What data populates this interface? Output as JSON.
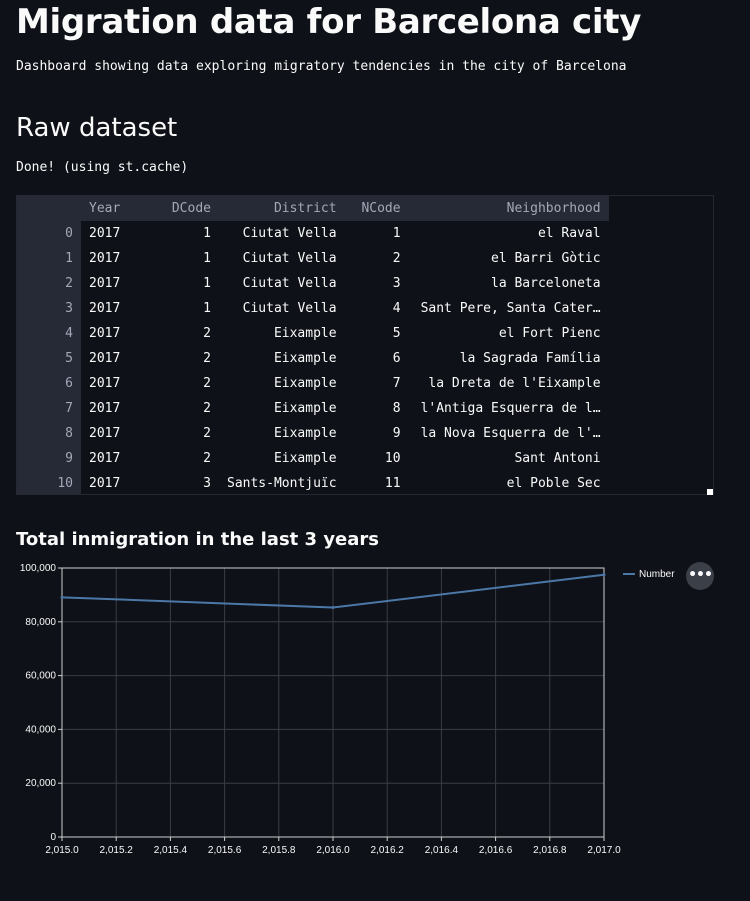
{
  "page": {
    "title": "Migration data for Barcelona city",
    "subtitle": "Dashboard showing data exploring migratory tendencies in the city of Barcelona",
    "section_title": "Raw dataset",
    "status": "Done! (using st.cache)"
  },
  "table": {
    "columns": [
      "Year",
      "DCode",
      "District",
      "NCode",
      "Neighborhood"
    ],
    "rows": [
      {
        "index": "0",
        "cells": [
          "2017",
          "1",
          "Ciutat Vella",
          "1",
          "el Raval"
        ]
      },
      {
        "index": "1",
        "cells": [
          "2017",
          "1",
          "Ciutat Vella",
          "2",
          "el Barri Gòtic"
        ]
      },
      {
        "index": "2",
        "cells": [
          "2017",
          "1",
          "Ciutat Vella",
          "3",
          "la Barceloneta"
        ]
      },
      {
        "index": "3",
        "cells": [
          "2017",
          "1",
          "Ciutat Vella",
          "4",
          "Sant Pere, Santa Cater…"
        ]
      },
      {
        "index": "4",
        "cells": [
          "2017",
          "2",
          "Eixample",
          "5",
          "el Fort Pienc"
        ]
      },
      {
        "index": "5",
        "cells": [
          "2017",
          "2",
          "Eixample",
          "6",
          "la Sagrada Família"
        ]
      },
      {
        "index": "6",
        "cells": [
          "2017",
          "2",
          "Eixample",
          "7",
          "la Dreta de l'Eixample"
        ]
      },
      {
        "index": "7",
        "cells": [
          "2017",
          "2",
          "Eixample",
          "8",
          "l'Antiga Esquerra de l…"
        ]
      },
      {
        "index": "8",
        "cells": [
          "2017",
          "2",
          "Eixample",
          "9",
          "la Nova Esquerra de l'…"
        ]
      },
      {
        "index": "9",
        "cells": [
          "2017",
          "2",
          "Eixample",
          "10",
          "Sant Antoni"
        ]
      },
      {
        "index": "10",
        "cells": [
          "2017",
          "3",
          "Sants-Montjuïc",
          "11",
          "el Poble Sec"
        ]
      }
    ]
  },
  "chart": {
    "title": "Total inmigration in the last 3 years",
    "menu_icon": "more-horizontal-icon",
    "menu_label": "•••"
  },
  "chart_data": {
    "type": "line",
    "title": "Total inmigration in the last 3 years",
    "xlabel": "",
    "ylabel": "",
    "xlim": [
      2015.0,
      2017.0
    ],
    "ylim": [
      0,
      100000
    ],
    "x_ticks": [
      "2,015.0",
      "2,015.2",
      "2,015.4",
      "2,015.6",
      "2,015.8",
      "2,016.0",
      "2,016.2",
      "2,016.4",
      "2,016.6",
      "2,016.8",
      "2,017.0"
    ],
    "y_ticks": [
      "0",
      "20,000",
      "40,000",
      "60,000",
      "80,000",
      "100,000"
    ],
    "grid": true,
    "legend_position": "right",
    "series": [
      {
        "name": "Number",
        "color": "#4c78a8",
        "x": [
          2015.0,
          2016.0,
          2017.0
        ],
        "y": [
          89100,
          85300,
          97500
        ]
      }
    ]
  }
}
